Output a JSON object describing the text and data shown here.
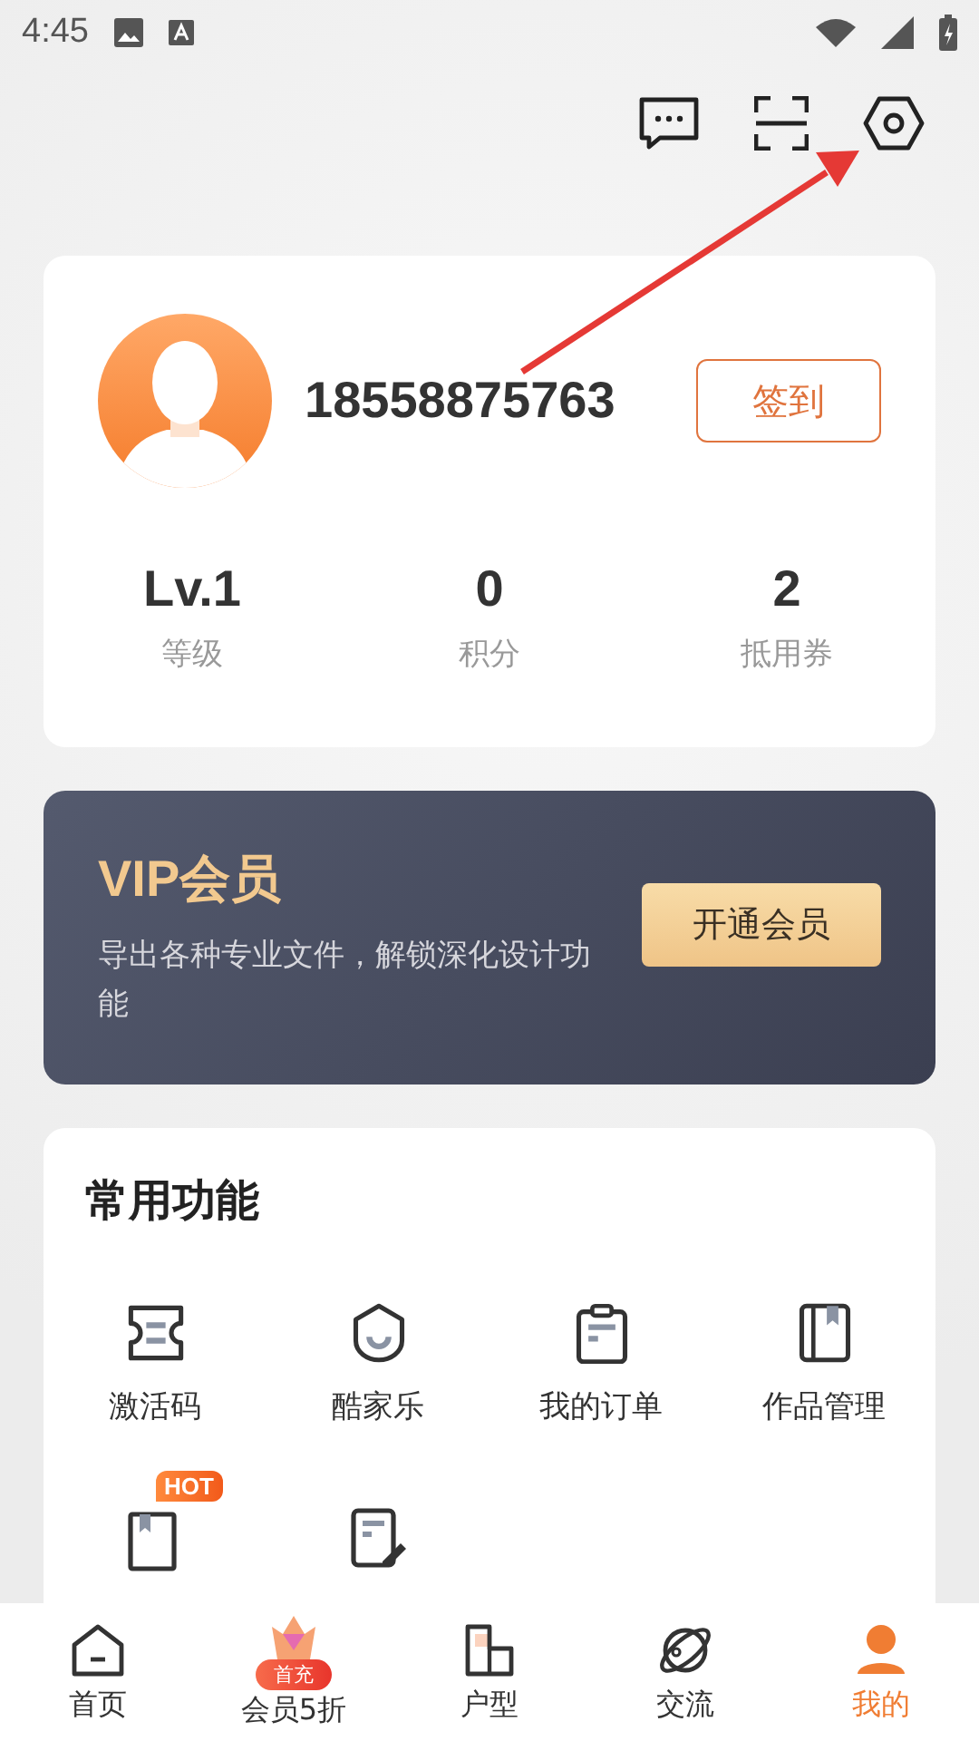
{
  "status_bar": {
    "time": "4:45"
  },
  "profile": {
    "phone": "18558875763",
    "checkin_button": "签到",
    "stats": [
      {
        "value": "Lv.1",
        "label": "等级"
      },
      {
        "value": "0",
        "label": "积分"
      },
      {
        "value": "2",
        "label": "抵用券"
      }
    ]
  },
  "vip": {
    "title": "VIP会员",
    "description": "导出各种专业文件，解锁深化设计功能",
    "button": "开通会员"
  },
  "functions": {
    "title": "常用功能",
    "items": [
      {
        "label": "激活码"
      },
      {
        "label": "酷家乐"
      },
      {
        "label": "我的订单"
      },
      {
        "label": "作品管理"
      }
    ],
    "more_items": [
      {
        "kind": "book",
        "badge": "HOT"
      },
      {
        "kind": "edit"
      }
    ]
  },
  "nav": [
    {
      "label": "首页",
      "selected": false
    },
    {
      "label": "会员5折",
      "selected": false,
      "badge": "首充"
    },
    {
      "label": "户型",
      "selected": false
    },
    {
      "label": "交流",
      "selected": false
    },
    {
      "label": "我的",
      "selected": true
    }
  ]
}
